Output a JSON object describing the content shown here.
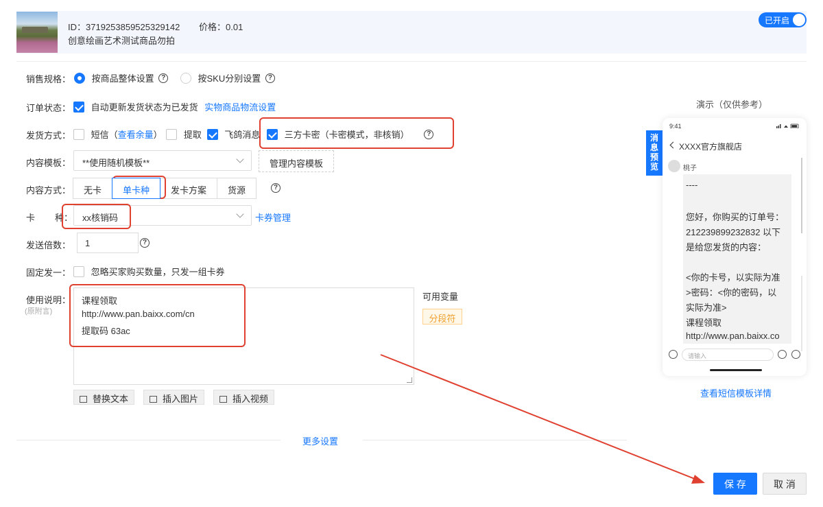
{
  "banner": {
    "id_text": "ID：3719253859525329142",
    "price_text": "价格：0.01",
    "product_name": "创意绘画艺术测试商品勿拍",
    "toggle_label": "已开启",
    "toggle_on": true
  },
  "form": {
    "sales_spec": {
      "label": "销售规格：",
      "options": [
        "按商品整体设置",
        "按SKU分别设置"
      ],
      "selected": "按商品整体设置"
    },
    "order_status": {
      "label": "订单状态：",
      "checkbox_label": "自动更新发货状态为已发货",
      "checked": true,
      "link": "实物商品物流设置"
    },
    "delivery": {
      "label": "发货方式：",
      "sms_label": "短信（",
      "sms_link": "查看余量",
      "sms_close": "）",
      "pickup_label": "提取",
      "feige_label": "飞鸽消息",
      "card_label": "三方卡密（卡密模式，非核销）",
      "sms_checked": false,
      "pickup_checked": false,
      "feige_checked": true,
      "card_checked": true
    },
    "template": {
      "label": "内容模板：",
      "value": "**使用随机模板**",
      "manage_button": "管理内容模板"
    },
    "content_mode": {
      "label": "内容方式：",
      "options": [
        "无卡",
        "单卡种",
        "发卡方案",
        "货源"
      ],
      "selected": "单卡种"
    },
    "card_type": {
      "label_a": "卡",
      "label_b": "种：",
      "value": "xx核销码",
      "link": "卡券管理"
    },
    "send_multiple": {
      "label": "发送倍数：",
      "value": "1"
    },
    "fixed_send": {
      "label": "固定发一：",
      "checkbox_label": "忽略买家购买数量，只发一组卡券",
      "checked": false
    },
    "instructions": {
      "label": "使用说明：",
      "sublabel": "(原附言)",
      "lines": [
        "课程领取",
        "http://www.pan.baixx.com/cn",
        "提取码 63ac"
      ],
      "variables_label": "可用变量",
      "separator_tag": "分段符"
    },
    "toolbar": {
      "replace_text": "替换文本",
      "insert_image": "插入图片",
      "insert_video": "插入视频"
    },
    "more_settings": "更多设置"
  },
  "preview": {
    "title": "演示（仅供参考）",
    "side_tab": "消息预览",
    "time": "9:41",
    "shop_name": "XXXX官方旗舰店",
    "username": "桃子",
    "bubble_lines": [
      "----",
      "",
      "您好，你购买的订单号：",
      "212239899232832 以下",
      "是给您发货的内容：",
      "",
      "<你的卡号，以实际为准",
      ">密码：<你的密码，以",
      "实际为准>",
      "课程领取",
      "http://www.pan.baixx.co"
    ],
    "input_placeholder": "请输入",
    "sms_detail_link": "查看短信模板详情"
  },
  "actions": {
    "save": "保 存",
    "cancel": "取 消"
  },
  "colors": {
    "accent": "#1677ff",
    "annotation_red": "#e0402f",
    "banner_bg": "#f3f7fd"
  }
}
